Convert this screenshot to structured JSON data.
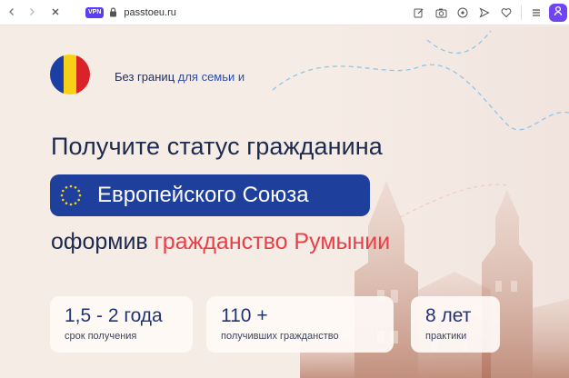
{
  "browser": {
    "vpn_label": "VPN",
    "url": "passtoeu.ru",
    "icons": {
      "back": "chevron-left-icon",
      "forward": "chevron-right-icon",
      "reload": "close-icon",
      "lock": "lock-icon",
      "edit": "edit-icon",
      "camera": "camera-icon",
      "shield": "shield-icon",
      "send": "send-icon",
      "heart": "heart-icon",
      "menu": "menu-icon",
      "profile": "user-icon"
    },
    "accent_color": "#6f45f2"
  },
  "hero": {
    "flag_colors": [
      "#1b3fa6",
      "#f7d117",
      "#d8232a"
    ],
    "tagline": {
      "lead": "Без границ ",
      "accent": "для семьи и"
    },
    "headline": "Получите статус гражданина",
    "eu_pill_text": "Европейского Союза",
    "subline": {
      "lead": "оформив ",
      "accent": "гражданство Румынии"
    },
    "colors": {
      "navy": "#1f3f9c",
      "red": "#ec3e47",
      "background": "#f6ece6"
    }
  },
  "stats": [
    {
      "value": "1,5 - 2 года",
      "label": "срок получения"
    },
    {
      "value": "110 +",
      "label": "получивших гражданство"
    },
    {
      "value": "8 лет",
      "label": "практики"
    }
  ]
}
